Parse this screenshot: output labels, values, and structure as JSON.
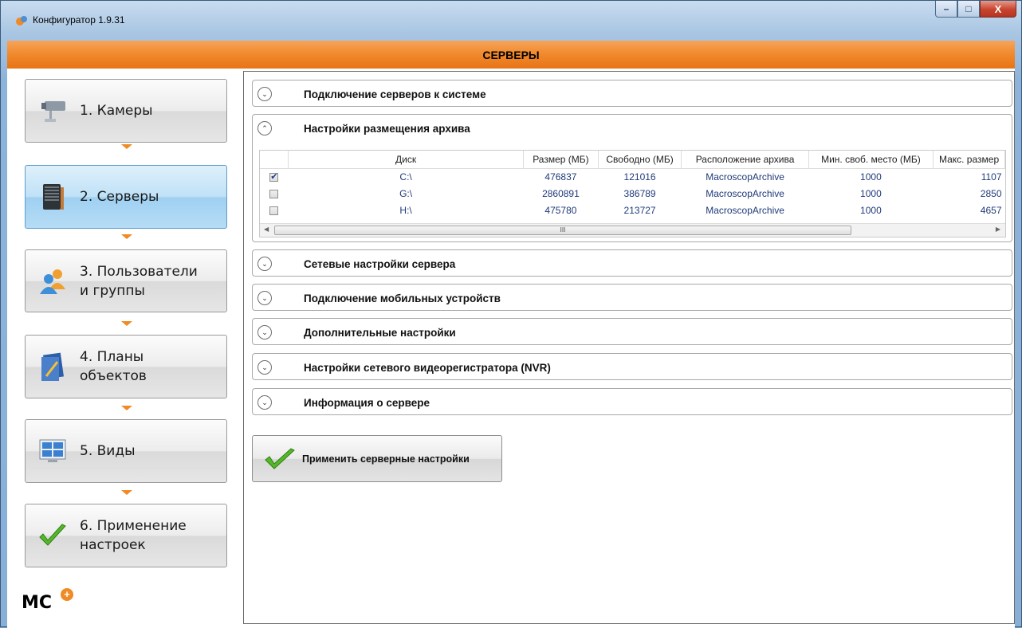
{
  "window": {
    "title": "Конфигуратор 1.9.31",
    "minimize": "–",
    "maximize": "□",
    "close": "X"
  },
  "header": {
    "title": "СЕРВЕРЫ"
  },
  "nav": {
    "steps": [
      {
        "line1": "1. Камеры",
        "line2": "",
        "icon": "camera-icon"
      },
      {
        "line1": "2. Серверы",
        "line2": "",
        "icon": "server-icon"
      },
      {
        "line1": "3. Пользователи",
        "line2": "и группы",
        "icon": "users-icon"
      },
      {
        "line1": "4. Планы",
        "line2": "объектов",
        "icon": "plan-icon"
      },
      {
        "line1": "5. Виды",
        "line2": "",
        "icon": "layout-icon"
      },
      {
        "line1": "6. Применение",
        "line2": "настроек",
        "icon": "checkmark-icon"
      }
    ],
    "active_index": 1,
    "logo": "MC",
    "logo_badge": "+"
  },
  "sections": [
    {
      "title": "Подключение серверов к системе",
      "expanded": false
    },
    {
      "title": "Настройки размещения архива",
      "expanded": true
    },
    {
      "title": "Сетевые настройки сервера",
      "expanded": false
    },
    {
      "title": "Подключение мобильных устройств",
      "expanded": false
    },
    {
      "title": "Дополнительные настройки",
      "expanded": false
    },
    {
      "title": "Настройки сетевого видеорегистратора (NVR)",
      "expanded": false
    },
    {
      "title": "Информация о сервере",
      "expanded": false
    }
  ],
  "archive_table": {
    "columns": [
      "Диск",
      "Размер (МБ)",
      "Свободно (МБ)",
      "Расположение архива",
      "Мин. своб. место (МБ)",
      "Макс. размер"
    ],
    "rows": [
      {
        "checked": true,
        "disk": "C:\\",
        "size": "476837",
        "free": "121016",
        "location": "MacroscopArchive",
        "min_free": "1000",
        "max_size": "1107"
      },
      {
        "checked": false,
        "disk": "G:\\",
        "size": "2860891",
        "free": "386789",
        "location": "MacroscopArchive",
        "min_free": "1000",
        "max_size": "2850"
      },
      {
        "checked": false,
        "disk": "H:\\",
        "size": "475780",
        "free": "213727",
        "location": "MacroscopArchive",
        "min_free": "1000",
        "max_size": "4657"
      }
    ],
    "scroll_thumb_label": "III"
  },
  "apply_button": {
    "label": "Применить серверные настройки"
  },
  "colors": {
    "accent_orange": "#f08a24",
    "active_blue": "#bfe1f7",
    "table_text": "#1f3a7a"
  }
}
